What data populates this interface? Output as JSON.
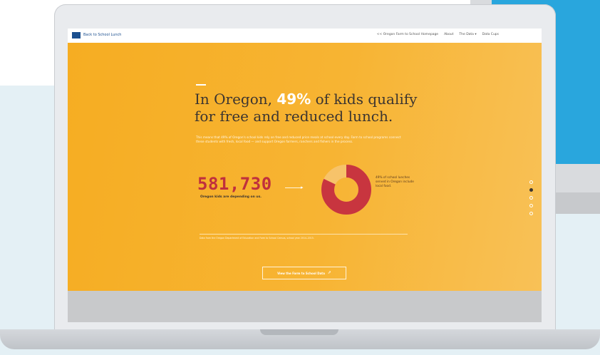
{
  "site": {
    "logo_text": "Back to School Lunch",
    "nav": [
      "<< Oregon Farm to School Homepage",
      "About",
      "The Data ▾",
      "Data Cups"
    ]
  },
  "hero": {
    "headline_before": "In Oregon, ",
    "headline_pct": "49%",
    "headline_after": " of kids qualify for free and reduced lunch.",
    "intro": "This means that 49% of Oregon's school kids rely on free and reduced price meals at school every day. Farm to school programs connect these students with fresh, local food — and support Oregon farmers, ranchers and fishers in the process.",
    "big_number": "581,730",
    "big_number_caption": "Oregon kids are depending on us.",
    "donut_caption": "49% of school lunches served in Oregon include local food.",
    "donut_pct": 0.82,
    "footnote": "Data from the Oregon Department of Education and Farm to School Census, school year 2014–2015.",
    "cta_label": "View the Farm to School Data",
    "cta_icon": "share-icon"
  },
  "section_nav": {
    "count": 5,
    "active_index": 1
  },
  "colors": {
    "accent_orange": "#f6ad22",
    "headline_dark": "#3c3530",
    "number_red": "#c0303d",
    "donut_red": "#c8353f",
    "monitor_blue": "#29a6dd"
  }
}
